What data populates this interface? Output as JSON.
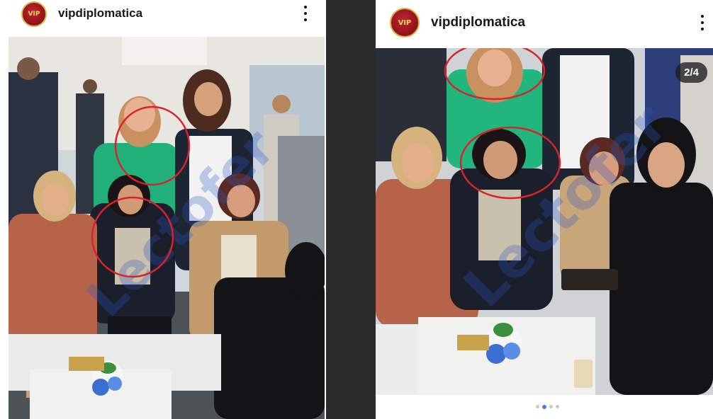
{
  "left_post": {
    "username": "vipdiplomatica",
    "avatar_text": "VIP",
    "menu_icon": "more-vertical-icon",
    "watermark_text": "Lectofer"
  },
  "right_post": {
    "username": "vipdiplomatica",
    "avatar_text": "VIP",
    "menu_icon": "more-vertical-icon",
    "carousel_counter": "2/4",
    "carousel_total": 4,
    "carousel_active_index": 1,
    "watermark_text": "Lectofer"
  },
  "colors": {
    "highlight_circle": "#d8232a",
    "watermark": "#2a58c8",
    "avatar_red": "#a5161e",
    "active_dot": "#3b82f6",
    "inactive_dot": "#c9c9c9",
    "divider": "#2b2b2b"
  }
}
